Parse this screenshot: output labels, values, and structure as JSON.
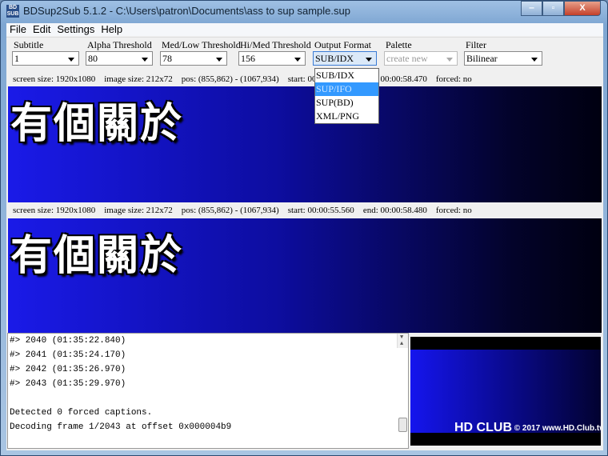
{
  "window": {
    "title": "BDSup2Sub 5.1.2 - C:\\Users\\patron\\Documents\\ass to sup sample.sup",
    "icon": "BD SUB",
    "minimize": "‒",
    "maximize": "▫",
    "close": "X"
  },
  "menu": [
    "File",
    "Edit",
    "Settings",
    "Help"
  ],
  "toolbar": {
    "subtitle": {
      "label": "Subtitle",
      "value": "1"
    },
    "alpha": {
      "label": "Alpha Threshold",
      "value": "80"
    },
    "medlow": {
      "label": "Med/Low Threshold",
      "value": "78"
    },
    "himed": {
      "label": "Hi/Med Threshold",
      "value": "156"
    },
    "output": {
      "label": "Output Format",
      "value": "SUB/IDX",
      "options": [
        "SUB/IDX",
        "SUP/IFO",
        "SUP(BD)",
        "XML/PNG"
      ],
      "highlighted": "SUP/IFO"
    },
    "palette": {
      "label": "Palette",
      "value": "create new",
      "disabled": true
    },
    "filter": {
      "label": "Filter",
      "value": "Bilinear"
    }
  },
  "info1": {
    "screen": "screen size: 1920x1080",
    "image": "image size: 212x72",
    "pos": "pos: (855,862) - (1067,934)",
    "start": "start: 00:00:55.560",
    "end": "end: 00:00:58.470",
    "forced": "forced: no"
  },
  "info2": {
    "screen": "screen size: 1920x1080",
    "image": "image size: 212x72",
    "pos": "pos: (855,862) - (1067,934)",
    "start": "start: 00:00:55.560",
    "end": "end: 00:00:58.480",
    "forced": "forced: no"
  },
  "preview1": {
    "subtitle_text": "有個關於"
  },
  "preview2": {
    "subtitle_text": "有個關於"
  },
  "log": [
    "#> 2040 (01:35:22.840)",
    "#> 2041 (01:35:24.170)",
    "#> 2042 (01:35:26.970)",
    "#> 2043 (01:35:29.970)",
    "",
    "Detected 0 forced captions.",
    "Decoding frame 1/2043 at offset 0x000004b9"
  ],
  "watermark": {
    "logo": "HD CLUB",
    "text": "© 2017 www.HD.Club.tw"
  },
  "colors": {
    "preview_blue": "#1a1ae8",
    "highlight": "#3399ff"
  }
}
